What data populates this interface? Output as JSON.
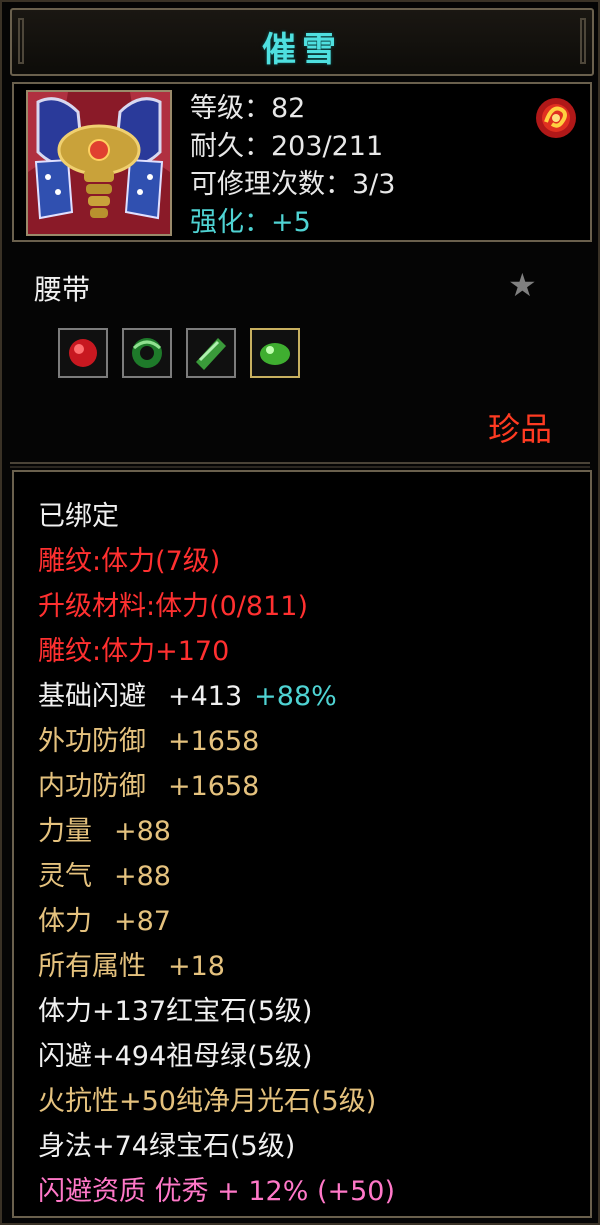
{
  "item": {
    "name": "催雪",
    "type": "腰带",
    "quality": "珍品",
    "icon": "belt-item-icon"
  },
  "stats": [
    {
      "label": "等级：",
      "value": "82",
      "kind": "normal"
    },
    {
      "label": "耐久：",
      "value": "203/211",
      "kind": "normal"
    },
    {
      "label": "可修理次数：",
      "value": "3/3",
      "kind": "normal"
    },
    {
      "label": "强化：",
      "value": "+5",
      "kind": "enh"
    }
  ],
  "gem_slots": [
    {
      "icon": "ruby-gem-icon",
      "color": "#d02028"
    },
    {
      "icon": "emerald-ring-gem-icon",
      "color": "#2fa03a"
    },
    {
      "icon": "moonstone-gem-icon",
      "color": "#4fb04a"
    },
    {
      "icon": "green-gem-icon",
      "color": "#48c040"
    }
  ],
  "attributes": [
    {
      "text": "已绑定",
      "value": "",
      "extra": "",
      "color": "white"
    },
    {
      "text": "雕纹:体力(7级)",
      "value": "",
      "extra": "",
      "color": "red"
    },
    {
      "text": "升级材料:体力(0/811)",
      "value": "",
      "extra": "",
      "color": "red"
    },
    {
      "text": "雕纹:体力+170",
      "value": "",
      "extra": "",
      "color": "red"
    },
    {
      "text": "基础闪避",
      "value": "+413",
      "extra": "+88%",
      "color": "white"
    },
    {
      "text": "外功防御",
      "value": "+1658",
      "extra": "",
      "color": "gold"
    },
    {
      "text": "内功防御",
      "value": "+1658",
      "extra": "",
      "color": "gold"
    },
    {
      "text": "力量",
      "value": "+88",
      "extra": "",
      "color": "gold"
    },
    {
      "text": "灵气",
      "value": "+88",
      "extra": "",
      "color": "gold"
    },
    {
      "text": "体力",
      "value": "+87",
      "extra": "",
      "color": "gold"
    },
    {
      "text": "所有属性",
      "value": "+18",
      "extra": "",
      "color": "gold"
    },
    {
      "text": "体力+137红宝石(5级)",
      "value": "",
      "extra": "",
      "color": "white"
    },
    {
      "text": "闪避+494祖母绿(5级)",
      "value": "",
      "extra": "",
      "color": "white"
    },
    {
      "text": "火抗性+50纯净月光石(5级)",
      "value": "",
      "extra": "",
      "color": "gold"
    },
    {
      "text": "身法+74绿宝石(5级)",
      "value": "",
      "extra": "",
      "color": "white"
    },
    {
      "text": "闪避资质 优秀 + 12% (+50)",
      "value": "",
      "extra": "",
      "color": "pink"
    }
  ],
  "colors": {
    "title": "#4fe0e0",
    "quality": "#ff3b22",
    "red": "#ff3030",
    "gold": "#e5c27e",
    "pink": "#ff78c8",
    "cyan": "#4fd3d3"
  }
}
